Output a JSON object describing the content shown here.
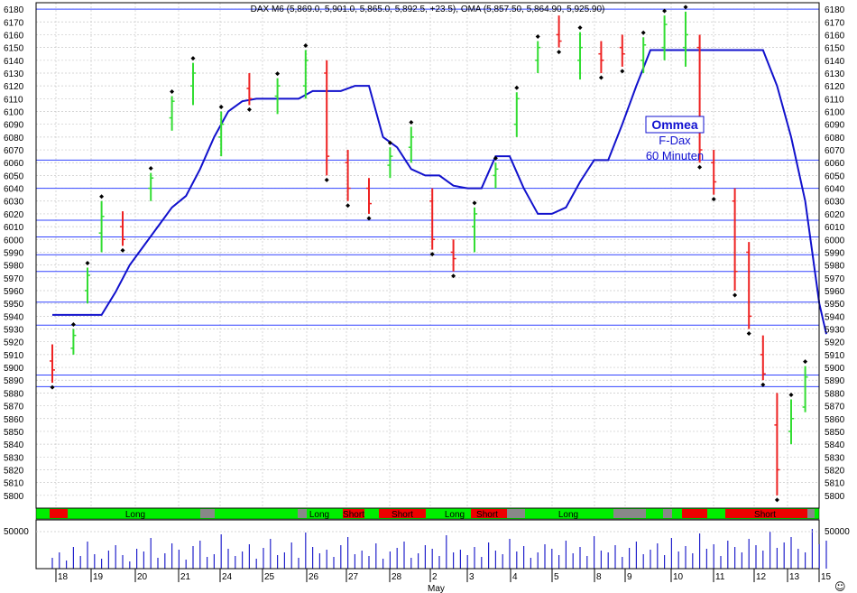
{
  "header": "DAX M6 (5,869.0, 5,901.0, 5,865.0, 5,892.5, +23.5), OMA (5,857.50, 5,864.90, 5,925.90)",
  "annotation": {
    "title": "Ommea",
    "line1": "F-Dax",
    "line2": "60 Minuten"
  },
  "colors": {
    "up": "#33dd33",
    "down": "#ee2222",
    "neutral": "#888888",
    "line": "#1111cc",
    "level": "#3344ff",
    "grid": "#c8c8c8",
    "dot": "#000000",
    "volume": "#2222cc"
  },
  "chart_data": {
    "type": "bar",
    "y_range": [
      5790,
      6185
    ],
    "y_ticks": [
      5800,
      5810,
      5820,
      5830,
      5840,
      5850,
      5860,
      5870,
      5880,
      5890,
      5900,
      5910,
      5920,
      5930,
      5940,
      5950,
      5960,
      5970,
      5980,
      5990,
      6000,
      6010,
      6020,
      6030,
      6040,
      6050,
      6060,
      6070,
      6080,
      6090,
      6100,
      6110,
      6120,
      6130,
      6140,
      6150,
      6160,
      6170,
      6180
    ],
    "x_ticks": [
      "18",
      "19",
      "20",
      "21",
      "24",
      "25",
      "26",
      "27",
      "28",
      "2",
      "3",
      "4",
      "5",
      "8",
      "9",
      "10",
      "11",
      "12",
      "13",
      "15"
    ],
    "month_label": "May",
    "horizontal_levels": [
      6180,
      6062,
      6040,
      6015,
      6002,
      5988,
      5975,
      5951,
      5933,
      5894,
      5885
    ],
    "slow_line": [
      [
        0,
        5941
      ],
      [
        7,
        5941
      ],
      [
        9,
        5959
      ],
      [
        11,
        5980
      ],
      [
        13,
        5995
      ],
      [
        15,
        6010
      ],
      [
        17,
        6025
      ],
      [
        19,
        6034
      ],
      [
        21,
        6055
      ],
      [
        23,
        6080
      ],
      [
        25,
        6100
      ],
      [
        27,
        6108
      ],
      [
        29,
        6110
      ],
      [
        35,
        6110
      ],
      [
        37,
        6116
      ],
      [
        41,
        6116
      ],
      [
        43,
        6120
      ],
      [
        45,
        6120
      ],
      [
        47,
        6080
      ],
      [
        49,
        6072
      ],
      [
        51,
        6055
      ],
      [
        53,
        6050
      ],
      [
        55,
        6050
      ],
      [
        57,
        6042
      ],
      [
        59,
        6040
      ],
      [
        61,
        6040
      ],
      [
        63,
        6065
      ],
      [
        65,
        6065
      ],
      [
        67,
        6040
      ],
      [
        69,
        6020
      ],
      [
        71,
        6020
      ],
      [
        73,
        6025
      ],
      [
        75,
        6045
      ],
      [
        77,
        6062
      ],
      [
        79,
        6062
      ],
      [
        81,
        6090
      ],
      [
        83,
        6120
      ],
      [
        85,
        6148
      ],
      [
        101,
        6148
      ],
      [
        103,
        6120
      ],
      [
        105,
        6080
      ],
      [
        107,
        6030
      ],
      [
        109,
        5950
      ],
      [
        110,
        5926
      ]
    ],
    "volume_axis_label": "50000",
    "bands": [
      {
        "label": "Long",
        "color": "#00ee00"
      },
      {
        "label": "Long",
        "color": "#00ee00"
      },
      {
        "label": "Short",
        "color": "#ee0000"
      },
      {
        "label": "Short",
        "color": "#ee0000"
      },
      {
        "label": "Long",
        "color": "#00ee00"
      },
      {
        "label": "Short",
        "color": "#ee0000"
      },
      {
        "label": "Long",
        "color": "#00ee00"
      },
      {
        "label": "Short",
        "color": "#ee0000"
      }
    ],
    "key_bars": [
      {
        "i": 0,
        "o": 5905,
        "h": 5918,
        "l": 5888,
        "c": 5898
      },
      {
        "i": 3,
        "o": 5915,
        "h": 5930,
        "l": 5910,
        "c": 5925
      },
      {
        "i": 5,
        "o": 5960,
        "h": 5978,
        "l": 5950,
        "c": 5972
      },
      {
        "i": 7,
        "o": 6005,
        "h": 6030,
        "l": 5990,
        "c": 6018
      },
      {
        "i": 10,
        "o": 6010,
        "h": 6022,
        "l": 5995,
        "c": 6000
      },
      {
        "i": 14,
        "o": 6040,
        "h": 6052,
        "l": 6030,
        "c": 6048
      },
      {
        "i": 17,
        "o": 6095,
        "h": 6112,
        "l": 6085,
        "c": 6108
      },
      {
        "i": 20,
        "o": 6120,
        "h": 6138,
        "l": 6105,
        "c": 6130
      },
      {
        "i": 24,
        "o": 6080,
        "h": 6100,
        "l": 6065,
        "c": 6090
      },
      {
        "i": 28,
        "o": 6118,
        "h": 6130,
        "l": 6105,
        "c": 6110
      },
      {
        "i": 32,
        "o": 6112,
        "h": 6126,
        "l": 6098,
        "c": 6120
      },
      {
        "i": 36,
        "o": 6120,
        "h": 6148,
        "l": 6110,
        "c": 6140
      },
      {
        "i": 39,
        "o": 6130,
        "h": 6140,
        "l": 6050,
        "c": 6065
      },
      {
        "i": 42,
        "o": 6060,
        "h": 6070,
        "l": 6030,
        "c": 6040
      },
      {
        "i": 45,
        "o": 6040,
        "h": 6048,
        "l": 6020,
        "c": 6028
      },
      {
        "i": 48,
        "o": 6058,
        "h": 6072,
        "l": 6048,
        "c": 6065
      },
      {
        "i": 51,
        "o": 6072,
        "h": 6088,
        "l": 6060,
        "c": 6080
      },
      {
        "i": 54,
        "o": 6030,
        "h": 6040,
        "l": 5992,
        "c": 6000
      },
      {
        "i": 57,
        "o": 5990,
        "h": 6000,
        "l": 5975,
        "c": 5985
      },
      {
        "i": 60,
        "o": 6010,
        "h": 6025,
        "l": 5990,
        "c": 6020
      },
      {
        "i": 63,
        "o": 6050,
        "h": 6060,
        "l": 6040,
        "c": 6055
      },
      {
        "i": 66,
        "o": 6090,
        "h": 6115,
        "l": 6080,
        "c": 6110
      },
      {
        "i": 69,
        "o": 6140,
        "h": 6155,
        "l": 6130,
        "c": 6150
      },
      {
        "i": 72,
        "o": 6160,
        "h": 6175,
        "l": 6150,
        "c": 6155
      },
      {
        "i": 75,
        "o": 6140,
        "h": 6162,
        "l": 6125,
        "c": 6150
      },
      {
        "i": 78,
        "o": 6145,
        "h": 6155,
        "l": 6130,
        "c": 6140
      },
      {
        "i": 81,
        "o": 6150,
        "h": 6160,
        "l": 6135,
        "c": 6145
      },
      {
        "i": 84,
        "o": 6140,
        "h": 6158,
        "l": 6130,
        "c": 6152
      },
      {
        "i": 87,
        "o": 6150,
        "h": 6175,
        "l": 6140,
        "c": 6168
      },
      {
        "i": 90,
        "o": 6150,
        "h": 6178,
        "l": 6135,
        "c": 6160
      },
      {
        "i": 92,
        "o": 6150,
        "h": 6160,
        "l": 6060,
        "c": 6070
      },
      {
        "i": 94,
        "o": 6060,
        "h": 6070,
        "l": 6035,
        "c": 6045
      },
      {
        "i": 97,
        "o": 6030,
        "h": 6040,
        "l": 5960,
        "c": 5975
      },
      {
        "i": 99,
        "o": 5990,
        "h": 5998,
        "l": 5930,
        "c": 5940
      },
      {
        "i": 101,
        "o": 5910,
        "h": 5925,
        "l": 5890,
        "c": 5895
      },
      {
        "i": 103,
        "o": 5855,
        "h": 5880,
        "l": 5800,
        "c": 5820
      },
      {
        "i": 105,
        "o": 5850,
        "h": 5875,
        "l": 5840,
        "c": 5860
      },
      {
        "i": 107,
        "o": 5869,
        "h": 5901,
        "l": 5865,
        "c": 5892.5
      }
    ]
  }
}
